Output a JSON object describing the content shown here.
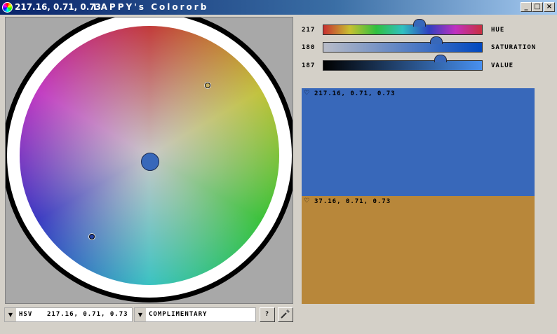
{
  "window": {
    "title_color": "217.16, 0.71, 0.73",
    "app_name": "LAPPY's Colororb",
    "minimize": "_",
    "maximize": "□",
    "close": "×"
  },
  "sliders": [
    {
      "name": "HUE",
      "value": "217",
      "fraction": 0.6
    },
    {
      "name": "SATURATION",
      "value": "180",
      "fraction": 0.706
    },
    {
      "name": "VALUE",
      "value": "187",
      "fraction": 0.733
    }
  ],
  "swatches": [
    {
      "label": "217.16, 0.71, 0.73",
      "color": "#3868ba"
    },
    {
      "label": "37.16, 0.71, 0.73",
      "color": "#b8873a"
    }
  ],
  "bottom": {
    "mode": "HSV",
    "mode_value": "217.16, 0.71, 0.73",
    "scheme": "COMPLIMENTARY",
    "help": "?"
  }
}
